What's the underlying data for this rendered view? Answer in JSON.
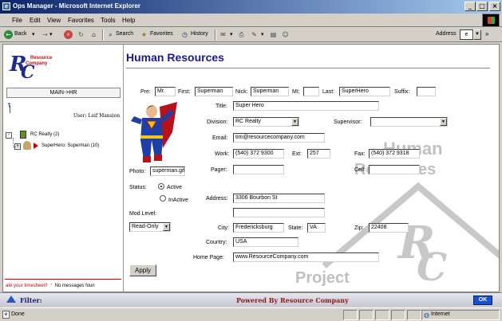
{
  "window": {
    "title": "Ops Manager - Microsoft Internet Explorer"
  },
  "menu": [
    "File",
    "Edit",
    "View",
    "Favorites",
    "Tools",
    "Help"
  ],
  "toolbar": {
    "back": "Back",
    "search": "Search",
    "favorites": "Favorites",
    "history": "History",
    "address_label": "Address",
    "address_value": "e"
  },
  "sidebar": {
    "logo_line1": "Resource",
    "logo_line2": "Company",
    "main_button": "MAIN->HR",
    "user_line": "User: Leif Mansion",
    "tree": [
      {
        "label": "RC Realty (2)"
      },
      {
        "label": "SuperHero: Superman (10)"
      }
    ],
    "marquee_red": "ate your timesheet!!",
    "marquee": "No messages foun"
  },
  "page": {
    "title": "Human Resources",
    "watermark_top": "Human",
    "watermark_mid": "Resources",
    "watermark_bottom": "Project"
  },
  "form": {
    "pre_label": "Pre:",
    "pre": "Mr.",
    "first_label": "First:",
    "first": "Superman",
    "nick_label": "Nick:",
    "nick": "Superman",
    "mi_label": "MI:",
    "mi": "",
    "last_label": "Last:",
    "last": "SuperHero",
    "suffix_label": "Suffix:",
    "suffix": "",
    "title_label": "Title:",
    "title": "Super Hero",
    "division_label": "Division:",
    "division": "RC Realty",
    "supervisor_label": "Supervisor:",
    "supervisor": "",
    "email_label": "Email:",
    "email": "tim@resourcecompany.com",
    "work_label": "Work:",
    "work": "(540) 372 9300",
    "ext_label": "Ext:",
    "ext": "257",
    "fax_label": "Fax:",
    "fax": "(540) 372 9318",
    "photo_label": "Photo:",
    "photo": "superman.gif",
    "pager_label": "Pager:",
    "pager": "",
    "cell_label": "Cell:",
    "cell": "",
    "status_label": "Status:",
    "status_active": "Active",
    "status_inactive": "InActive",
    "status_selected": "Active",
    "address_label": "Address:",
    "address": "3306 Bourbon St",
    "address2": "",
    "mod_level_label": "Mod Level:",
    "mod_level": "Read-Only",
    "city_label": "City:",
    "city": "Fredericksburg",
    "state_label": "State:",
    "state": "VA",
    "zip_label": "Zip:",
    "zip": "22408",
    "country_label": "Country:",
    "country": "USA",
    "homepage_label": "Home Page:",
    "homepage": "www.ResourceCompany.com",
    "apply": "Apply"
  },
  "filterbar": {
    "filter": "Filter:",
    "powered": "Powered By Resource Company",
    "ok": "OK"
  },
  "statusbar": {
    "status": "Done",
    "zone": "Internet"
  }
}
